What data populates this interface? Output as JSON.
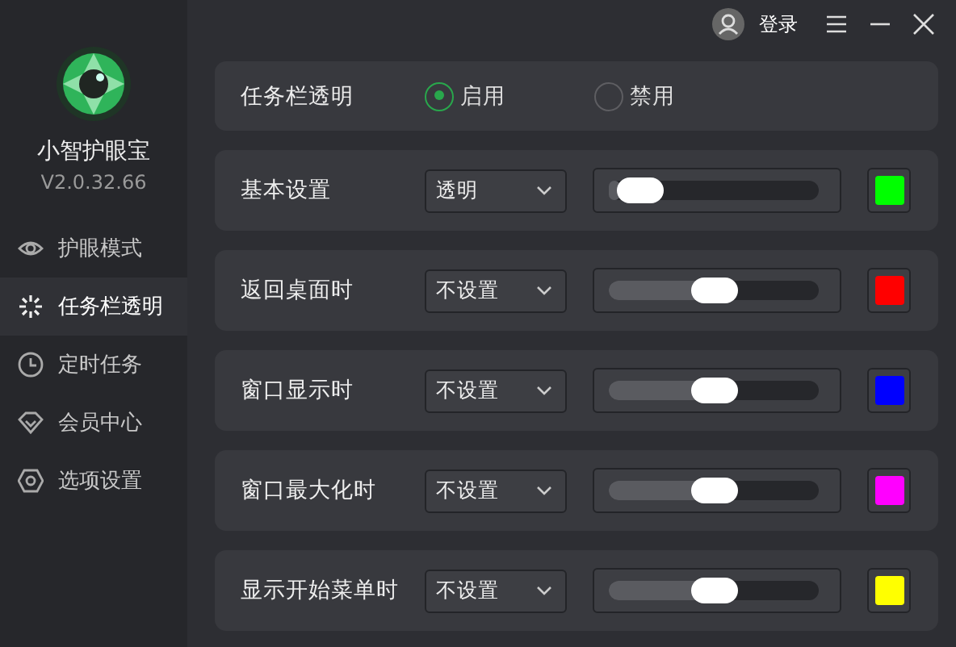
{
  "app": {
    "name": "小智护眼宝",
    "version": "V2.0.32.66"
  },
  "sidebar": {
    "items": [
      {
        "label": "护眼模式",
        "selected": false
      },
      {
        "label": "任务栏透明",
        "selected": true
      },
      {
        "label": "定时任务",
        "selected": false
      },
      {
        "label": "会员中心",
        "selected": false
      },
      {
        "label": "选项设置",
        "selected": false
      }
    ]
  },
  "titlebar": {
    "login": "登录"
  },
  "toggle": {
    "label": "任务栏透明",
    "options": [
      {
        "label": "启用",
        "selected": true
      },
      {
        "label": "禁用",
        "selected": false
      }
    ]
  },
  "rows": [
    {
      "label": "基本设置",
      "mode": "透明",
      "level": 0.05,
      "color": "#00ff00"
    },
    {
      "label": "返回桌面时",
      "mode": "不设置",
      "level": 0.5,
      "color": "#ff0000"
    },
    {
      "label": "窗口显示时",
      "mode": "不设置",
      "level": 0.5,
      "color": "#0000ff"
    },
    {
      "label": "窗口最大化时",
      "mode": "不设置",
      "level": 0.5,
      "color": "#ff00ff"
    },
    {
      "label": "显示开始菜单时",
      "mode": "不设置",
      "level": 0.5,
      "color": "#ffff00"
    }
  ]
}
